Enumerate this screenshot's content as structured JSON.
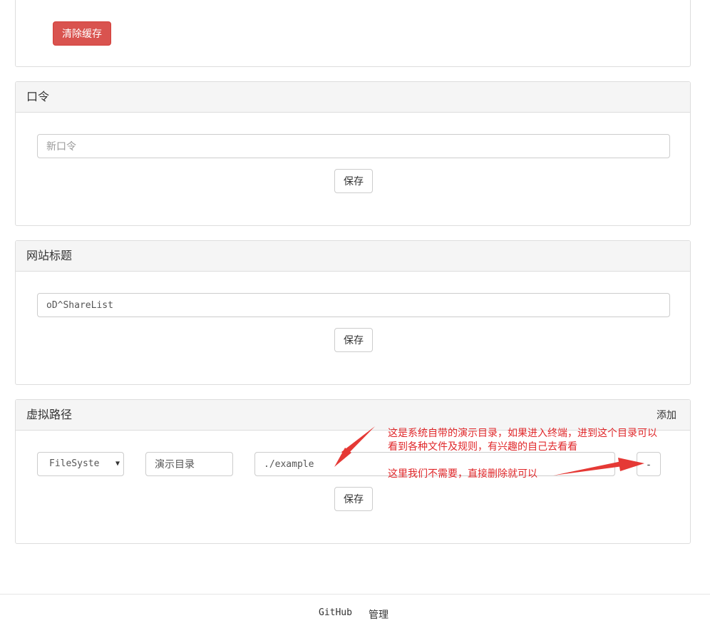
{
  "cache_panel": {
    "clear_cache_label": "清除缓存"
  },
  "password_panel": {
    "title": "口令",
    "new_password_placeholder": "新口令",
    "save_label": "保存"
  },
  "site_title_panel": {
    "title": "网站标题",
    "site_title_value": "oD^ShareList",
    "save_label": "保存"
  },
  "virtual_path_panel": {
    "title": "虚拟路径",
    "add_label": "添加",
    "rows": [
      {
        "type_selected": "FileSyste",
        "name_value": "演示目录",
        "path_value": "./example",
        "remove_label": "-"
      }
    ],
    "save_label": "保存"
  },
  "annotations": {
    "note_1_line_1": "这是系统自带的演示目录，如果进入终端，进到这个目录可以",
    "note_1_line_2": "看到各种文件及规则，有兴趣的自己去看看",
    "note_2": "这里我们不需要，直接删除就可以",
    "arrow_color": "#e53935"
  },
  "footer": {
    "github_label": "GitHub",
    "admin_label": "管理"
  },
  "colors": {
    "danger_button": "#d9534f",
    "panel_heading_bg": "#f5f5f5",
    "annotation_text": "#e0272a"
  }
}
